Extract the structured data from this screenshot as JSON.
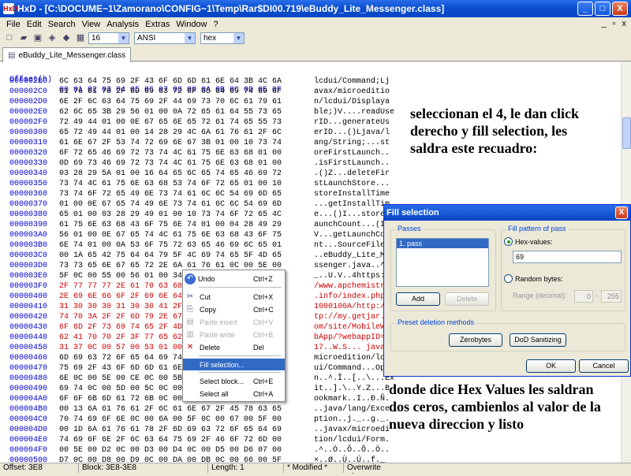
{
  "window": {
    "app_icon": "HxD",
    "title": "HxD - [C:\\DOCUME~1\\Zamorano\\CONFIG~1\\Temp\\Rar$DI00.719\\eBuddy_Lite_Messenger.class]",
    "min": "_",
    "max": "□",
    "close": "X"
  },
  "menu": {
    "items": [
      "File",
      "Edit",
      "Search",
      "View",
      "Analysis",
      "Extras",
      "Window",
      "?"
    ],
    "mdi": [
      "_",
      "▫",
      "x"
    ]
  },
  "toolbar": {
    "bytes_per_row": "16",
    "charset": "ANSI",
    "display": "hex"
  },
  "tab": {
    "label": "eBuddy_Lite_Messenger.class"
  },
  "hex": {
    "header_offset": "Offset(h)",
    "header_bytes": "00 01 02 03 04 05 06 07 08 09 0A 0B 0C 0D 0E 0F",
    "rows": [
      {
        "off": "000002B0",
        "bytes": "6C 63 64 75 69 2F 43 6F 6D 6D 61 6E 64 3B 4C 6A",
        "ascii": "lcdui/Command;Lj"
      },
      {
        "off": "000002C0",
        "bytes": "61 76 61 78 2F 6D 69 63 72 6F 65 64 69 74 69 6F",
        "ascii": "avax/microeditio"
      },
      {
        "off": "000002D0",
        "bytes": "6E 2F 6C 63 64 75 69 2F 44 69 73 70 6C 61 79 61",
        "ascii": "n/lcdui/Displaya"
      },
      {
        "off": "000002E0",
        "bytes": "62 6C 65 3B 29 56 01 00 0A 72 65 61 64 55 73 65",
        "ascii": "ble;)V....readUse"
      },
      {
        "off": "000002F0",
        "bytes": "72 49 44 01 00 0E 67 65 6E 65 72 61 74 65 55 73",
        "ascii": "rID...generateUs"
      },
      {
        "off": "00000300",
        "bytes": "65 72 49 44 01 00 14 28 29 4C 6A 61 76 61 2F 6C",
        "ascii": "erID...()Ljava/l"
      },
      {
        "off": "00000310",
        "bytes": "61 6E 67 2F 53 74 72 69 6E 67 3B 01 00 10 73 74",
        "ascii": "ang/String;...st"
      },
      {
        "off": "00000320",
        "bytes": "6F 72 65 46 69 72 73 74 4C 61 75 6E 63 68 01 00",
        "ascii": "oreFirstLaunch.."
      },
      {
        "off": "00000330",
        "bytes": "0D 69 73 46 69 72 73 74 4C 61 75 6E 63 68 01 00",
        "ascii": ".isFirstLaunch.."
      },
      {
        "off": "00000340",
        "bytes": "03 28 29 5A 01 00 16 64 65 6C 65 74 65 46 69 72",
        "ascii": ".()Z...deleteFir"
      },
      {
        "off": "00000350",
        "bytes": "73 74 4C 61 75 6E 63 68 53 74 6F 72 65 01 00 10",
        "ascii": "stLaunchStore..."
      },
      {
        "off": "00000360",
        "bytes": "73 74 6F 72 65 49 6E 73 74 61 6C 6C 54 69 6D 65",
        "ascii": "storeInstallTime"
      },
      {
        "off": "00000370",
        "bytes": "01 00 0E 67 65 74 49 6E 73 74 61 6C 6C 54 69 6D",
        "ascii": "...getInstallTim"
      },
      {
        "off": "00000380",
        "bytes": "65 01 00 03 28 29 49 01 00 10 73 74 6F 72 65 4C",
        "ascii": "e...()I...storeL"
      },
      {
        "off": "00000390",
        "bytes": "61 75 6E 63 68 43 6F 75 6E 74 01 00 04 28 49 29",
        "ascii": "aunchCount...(I)"
      },
      {
        "off": "000003A0",
        "bytes": "56 01 00 0E 67 65 74 4C 61 75 6E 63 68 43 6F 75",
        "ascii": "V...getLaunchCou"
      },
      {
        "off": "000003B0",
        "bytes": "6E 74 01 00 0A 53 6F 75 72 63 65 46 69 6C 65 01",
        "ascii": "nt...SourceFile."
      },
      {
        "off": "000003C0",
        "bytes": "00 1A 65 42 75 64 64 79 5F 4C 69 74 65 5F 4D 65",
        "ascii": "..eBuddy_Lite_Me"
      },
      {
        "off": "000003D0",
        "bytes": "73 73 65 6E 67 65 72 2E 6A 61 76 61 0C 00 5E 00",
        "ascii": "ssenger.java..^."
      },
      {
        "off": "000003E0",
        "bytes": "5F 0C 00 55 00 56 01 00 34 68 74 74 70 73 3A 2F",
        "ascii": "_..U.V..4https:/"
      },
      {
        "off": "000003F0",
        "bytes": "2F 77 77 77 2E 61 70 63 68 65 6D 69 73 74 72 79",
        "ascii": "/www.apchemistry"
      },
      {
        "off": "00000400",
        "bytes": "2E 69 6E 66 6F 2F 69 6E 64 65 78 2E 70 68 70 2F",
        "ascii": ".info/index.php/"
      },
      {
        "off": "00000410",
        "bytes": "31 30 30 30 31 30 30 41 2F 68 74 74 70 3A 2F 2F",
        "ascii": "1000100A/http://"
      },
      {
        "off": "00000420",
        "bytes": "74 70 3A 2F 2F 6D 79 2E 67 65 74 6A 61 72 2E 63",
        "ascii": "tp://my.getjar.c"
      },
      {
        "off": "00000430",
        "bytes": "6F 6D 2F 73 69 74 65 2F 4D 6F 62 69 6C 65 57 65",
        "ascii": "om/site/MobileWe"
      },
      {
        "off": "00000440",
        "bytes": "62 41 70 70 2F 3F 77 65 62 61 70 70 49 44 3D 31",
        "ascii": "bApp/?webappID=1"
      },
      {
        "off": "00000450",
        "bytes": "31 37 0C 00 57 00 53 01 00 1F 6A 61 76 61 78 2F",
        "ascii": "17..W.S... javax/"
      },
      {
        "off": "00000460",
        "bytes": "6D 69 63 72 6F 65 64 69 74 69 6F 6E 2F 6C 63 64",
        "ascii": "microedition/lcd"
      },
      {
        "off": "00000470",
        "bytes": "75 69 2F 43 6F 6D 6D 61 6E 64 01 00 04 4F 70 65",
        "ascii": "ui/Command...Ope"
      },
      {
        "off": "00000480",
        "bytes": "6E 0C 00 5E 00 CE 0C 00 5B 00 2E 0C 00 5C 00 45",
        "ascii": "n..^.Î..[..\\...Ex"
      },
      {
        "off": "00000490",
        "bytes": "69 74 0C 00 5D 00 5C 0C 00 59 00 5A 0C 00 5E 00",
        "ascii": "it..].\\..Y.Z...B"
      },
      {
        "off": "000004A0",
        "bytes": "6F 6F 6B 6D 61 72 6B 0C 00 49 00 D0 0C 00 4E 00",
        "ascii": "ookmark..I..Ð.Ñ."
      },
      {
        "off": "000004B0",
        "bytes": "00 13 6A 61 76 61 2F 6C 61 6E 67 2F 45 78 63 65",
        "ascii": "..java/lang/Exce"
      },
      {
        "off": "000004C0",
        "bytes": "70 74 69 6F 6E 0C 00 6A 00 5F 0C 00 67 00 5F 00",
        "ascii": "ption..j._..g._."
      },
      {
        "off": "000004D0",
        "bytes": "00 1D 6A 61 76 61 78 2F 6D 69 63 72 6F 65 64 69",
        "ascii": "..javax/microedi"
      },
      {
        "off": "000004E0",
        "bytes": "74 69 6F 6E 2F 6C 63 64 75 69 2F 46 6F 72 6D 00",
        "ascii": "tion/lcdui/Form."
      },
      {
        "off": "000004F0",
        "bytes": "00 5E 00 D2 0C 00 D3 00 D4 0C 00 D5 00 D6 07 00",
        "ascii": ".^..Ó..Ô..Õ..Ö.."
      },
      {
        "off": "00000500",
        "bytes": "D7 0C 00 D8 00 D9 0C 00 DA 00 DB 0C 00 66 00 5F",
        "ascii": "×..Ø..Ù..Ú..f._"
      },
      {
        "off": "00000510",
        "bytes": "0C 00 6E 00 6F 0C 00 70 00 5F 0C 00 DC 00 5F 0C",
        "ascii": "..n..o..p._..Ü._."
      }
    ]
  },
  "annotations": {
    "top": "seleccionan el 4, le dan click derecho y fill selection, les saldra este recuadro:",
    "bottom": "donde dice Hex Values les saldran dos ceros, cambienlos al valor de la nueva direccion y listo"
  },
  "context_menu": {
    "items": [
      {
        "icon": "↶",
        "label": "Undo",
        "shortcut": "Ctrl+Z",
        "enabled": true
      },
      {
        "icon": "✂",
        "label": "Cut",
        "shortcut": "Ctrl+X",
        "enabled": true
      },
      {
        "icon": "⎘",
        "label": "Copy",
        "shortcut": "Ctrl+C",
        "enabled": true
      },
      {
        "icon": "▤",
        "label": "Paste insert",
        "shortcut": "Ctrl+V",
        "enabled": false
      },
      {
        "icon": "▥",
        "label": "Paste write",
        "shortcut": "Ctrl+B",
        "enabled": false
      },
      {
        "icon": "✕",
        "label": "Delete",
        "shortcut": "Del",
        "enabled": true
      },
      {
        "icon": "",
        "label": "Fill selection...",
        "shortcut": "",
        "enabled": true,
        "highlighted": true
      },
      {
        "icon": "",
        "label": "Select block...",
        "shortcut": "Ctrl+E",
        "enabled": true
      },
      {
        "icon": "",
        "label": "Select all",
        "shortcut": "Ctrl+A",
        "enabled": true
      }
    ]
  },
  "dialog": {
    "title": "Fill selection",
    "close": "X",
    "passes_label": "Passes",
    "passes_item": "1. pass",
    "add": "Add",
    "delete": "Delete",
    "pattern_label": "Fill pattern of pass",
    "hex_values_label": "Hex-values:",
    "hex_value": "69",
    "random_label": "Random bytes:",
    "range_label": "Range (decimal):",
    "range_from": "0",
    "range_to": "255",
    "range_sep": "-",
    "preset_label": "Preset deletion methods",
    "zerobytes": "Zerobytes",
    "dod": "DoD Sanitizing",
    "ok": "OK",
    "cancel": "Cancel"
  },
  "status": {
    "offset": "Offset: 3E8",
    "block": "Block: 3E8-3E8",
    "length": "Length: 1",
    "modified": "* Modified *",
    "mode": "Overwrite"
  }
}
